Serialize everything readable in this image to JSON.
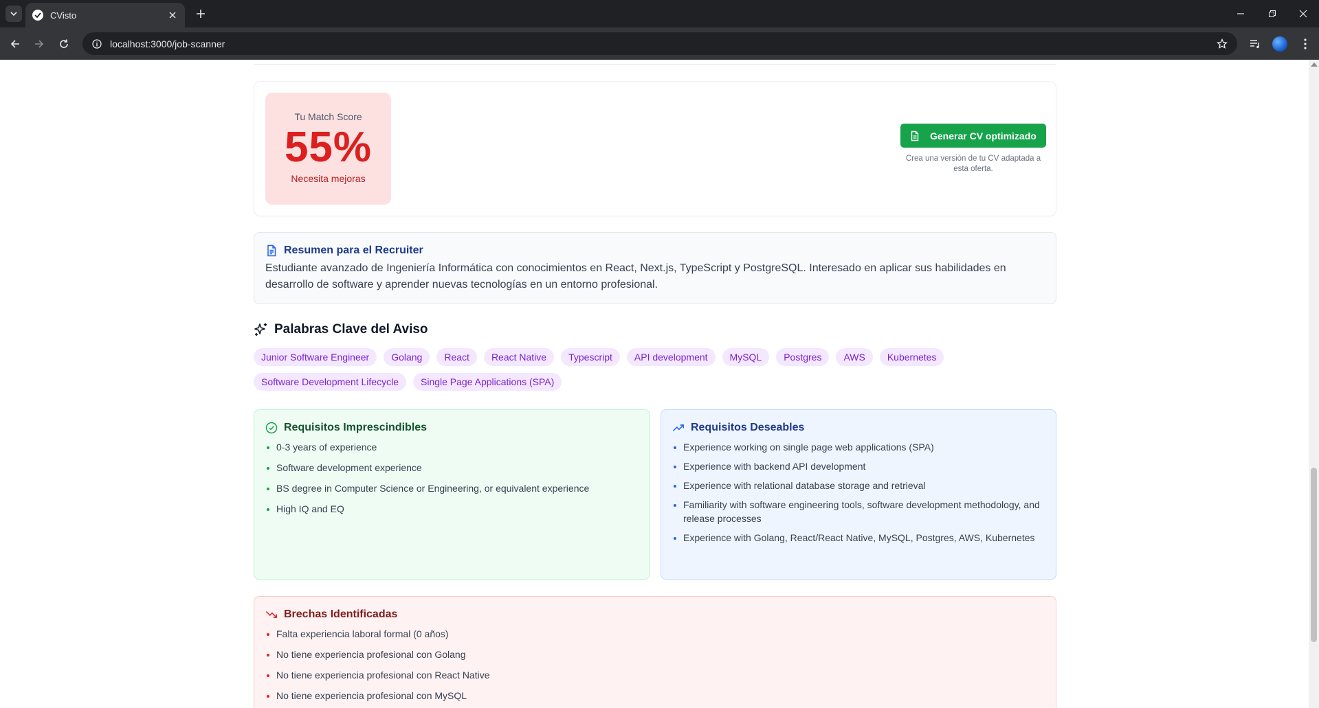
{
  "browser": {
    "tab_title": "CVisto",
    "url": "localhost:3000/job-scanner"
  },
  "score": {
    "label": "Tu Match Score",
    "value": "55%",
    "status": "Necesita mejoras",
    "color": "#dc1f1f"
  },
  "generate": {
    "button_label": "Generar CV optimizado",
    "help_text": "Crea una versión de tu CV adaptada a esta oferta.",
    "color": "#16a34a"
  },
  "summary": {
    "heading": "Resumen para el Recruiter",
    "text": "Estudiante avanzado de Ingeniería Informática con conocimientos en React, Next.js, TypeScript y PostgreSQL. Interesado en aplicar sus habilidades en desarrollo de software y aprender nuevas tecnologías en un entorno profesional."
  },
  "keywords": {
    "heading": "Palabras Clave del Aviso",
    "items": [
      "Junior Software Engineer",
      "Golang",
      "React",
      "React Native",
      "Typescript",
      "API development",
      "MySQL",
      "Postgres",
      "AWS",
      "Kubernetes",
      "Software Development Lifecycle",
      "Single Page Applications (SPA)"
    ]
  },
  "requirements_must": {
    "heading": "Requisitos Imprescindibles",
    "items": [
      "0-3 years of experience",
      "Software development experience",
      "BS degree in Computer Science or Engineering, or equivalent experience",
      "High IQ and EQ"
    ]
  },
  "requirements_nice": {
    "heading": "Requisitos Deseables",
    "items": [
      "Experience working on single page web applications (SPA)",
      "Experience with backend API development",
      "Experience with relational database storage and retrieval",
      "Familiarity with software engineering tools, software development methodology, and release processes",
      "Experience with Golang, React/React Native, MySQL, Postgres, AWS, Kubernetes"
    ]
  },
  "gaps": {
    "heading": "Brechas Identificadas",
    "items": [
      "Falta experiencia laboral formal (0 años)",
      "No tiene experiencia profesional con Golang",
      "No tiene experiencia profesional con React Native",
      "No tiene experiencia profesional con MySQL"
    ]
  }
}
